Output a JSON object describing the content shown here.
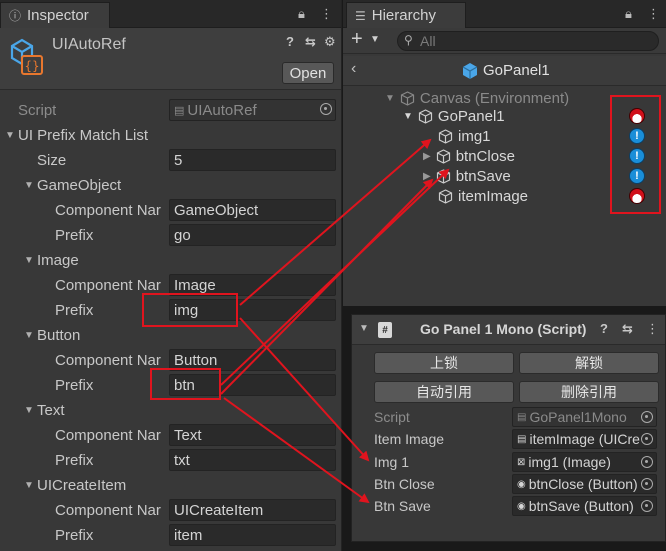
{
  "inspector": {
    "tab_title": "Inspector",
    "component_title": "UIAutoRef",
    "open_label": "Open",
    "script_label": "Script",
    "script_value": "UIAutoRef",
    "list_label": "UI Prefix Match List",
    "size_label": "Size",
    "size_value": "5",
    "groups": [
      {
        "name": "GameObject",
        "component_label": "Component Nar",
        "component_value": "GameObject",
        "prefix_label": "Prefix",
        "prefix_value": "go"
      },
      {
        "name": "Image",
        "component_label": "Component Nar",
        "component_value": "Image",
        "prefix_label": "Prefix",
        "prefix_value": "img"
      },
      {
        "name": "Button",
        "component_label": "Component Nar",
        "component_value": "Button",
        "prefix_label": "Prefix",
        "prefix_value": "btn"
      },
      {
        "name": "Text",
        "component_label": "Component Nar",
        "component_value": "Text",
        "prefix_label": "Prefix",
        "prefix_value": "txt"
      },
      {
        "name": "UICreateItem",
        "component_label": "Component Nar",
        "component_value": "UICreateItem",
        "prefix_label": "Prefix",
        "prefix_value": "item"
      }
    ]
  },
  "hierarchy": {
    "tab_title": "Hierarchy",
    "search_placeholder": "All",
    "breadcrumb": "GoPanel1",
    "rows": [
      {
        "label": "Canvas (Environment)",
        "status": ""
      },
      {
        "label": "GoPanel1",
        "status": "red"
      },
      {
        "label": "img1",
        "status": "blue"
      },
      {
        "label": "btnClose",
        "status": "blue"
      },
      {
        "label": "btnSave",
        "status": "blue"
      },
      {
        "label": "itemImage",
        "status": "red"
      }
    ],
    "status_glyph": "!"
  },
  "mono": {
    "title": "Go Panel 1 Mono (Script)",
    "buttons": [
      "上锁",
      "解锁",
      "自动引用",
      "删除引用"
    ],
    "fields": [
      {
        "label": "Script",
        "value": "GoPanel1Mono",
        "dim": true
      },
      {
        "label": "Item Image",
        "value": "itemImage (UICre"
      },
      {
        "label": "Img 1",
        "value": "img1 (Image)"
      },
      {
        "label": "Btn Close",
        "value": "btnClose (Button)"
      },
      {
        "label": "Btn Save",
        "value": "btnSave (Button)"
      }
    ]
  },
  "colors": {
    "highlight": "#e0141e",
    "panel_bg": "#383838",
    "field_bg": "#2a2a2a"
  }
}
